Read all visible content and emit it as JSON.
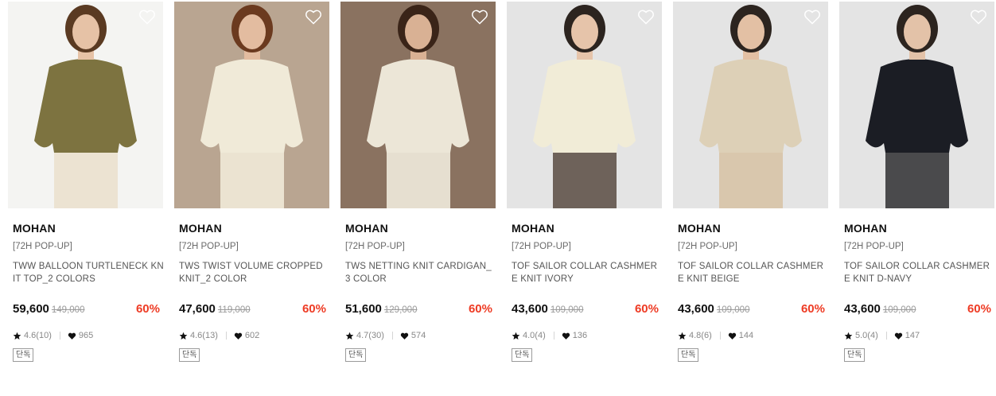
{
  "products": [
    {
      "brand": "MOHAN",
      "tag": "[72H POP-UP]",
      "name": "TWW BALLOON TURTLENECK KNIT TOP_2 COLORS",
      "price": "59,600",
      "original_price": "149,000",
      "discount": "60%",
      "rating": "4.6(10)",
      "likes": "965",
      "badge": "단독",
      "colors": {
        "bg": "#f4f4f2",
        "top": "#7d7340",
        "bottom": "#ece3d2",
        "skin": "#e6c2a6",
        "hair": "#5a3a22"
      }
    },
    {
      "brand": "MOHAN",
      "tag": "[72H POP-UP]",
      "name": "TWS TWIST VOLUME CROPPED KNIT_2 COLOR",
      "price": "47,600",
      "original_price": "119,000",
      "discount": "60%",
      "rating": "4.6(13)",
      "likes": "602",
      "badge": "단독",
      "colors": {
        "bg": "#b9a591",
        "top": "#f0ead8",
        "bottom": "#ebe3d1",
        "skin": "#e3bca0",
        "hair": "#6b3a1f"
      }
    },
    {
      "brand": "MOHAN",
      "tag": "[72H POP-UP]",
      "name": "TWS NETTING KNIT CARDIGAN_3 COLOR",
      "price": "51,600",
      "original_price": "129,000",
      "discount": "60%",
      "rating": "4.7(30)",
      "likes": "574",
      "badge": "단독",
      "colors": {
        "bg": "#8a7260",
        "top": "#ece6d7",
        "bottom": "#e6dfd0",
        "skin": "#d9b194",
        "hair": "#3a2418"
      }
    },
    {
      "brand": "MOHAN",
      "tag": "[72H POP-UP]",
      "name": "TOF SAILOR COLLAR CASHMERE KNIT IVORY",
      "price": "43,600",
      "original_price": "109,000",
      "discount": "60%",
      "rating": "4.0(4)",
      "likes": "136",
      "badge": "단독",
      "colors": {
        "bg": "#e4e4e4",
        "top": "#f1ecd7",
        "bottom": "#6e625a",
        "skin": "#e6c4aa",
        "hair": "#2c241f"
      }
    },
    {
      "brand": "MOHAN",
      "tag": "[72H POP-UP]",
      "name": "TOF SAILOR COLLAR CASHMERE KNIT BEIGE",
      "price": "43,600",
      "original_price": "109,000",
      "discount": "60%",
      "rating": "4.8(6)",
      "likes": "144",
      "badge": "단독",
      "colors": {
        "bg": "#e4e4e4",
        "top": "#ddd0b7",
        "bottom": "#d9c7ad",
        "skin": "#e3c0a4",
        "hair": "#2c241f"
      }
    },
    {
      "brand": "MOHAN",
      "tag": "[72H POP-UP]",
      "name": "TOF SAILOR COLLAR CASHMERE KNIT D-NAVY",
      "price": "43,600",
      "original_price": "109,000",
      "discount": "60%",
      "rating": "5.0(4)",
      "likes": "147",
      "badge": "단독",
      "colors": {
        "bg": "#e4e4e4",
        "top": "#1b1d24",
        "bottom": "#4a4a4c",
        "skin": "#e3c2a8",
        "hair": "#2c241f"
      }
    }
  ],
  "icons": {
    "wishlist": "heart-outline-icon",
    "rating": "star-icon",
    "likes": "heart-icon"
  },
  "accent_color": "#ee3b24"
}
